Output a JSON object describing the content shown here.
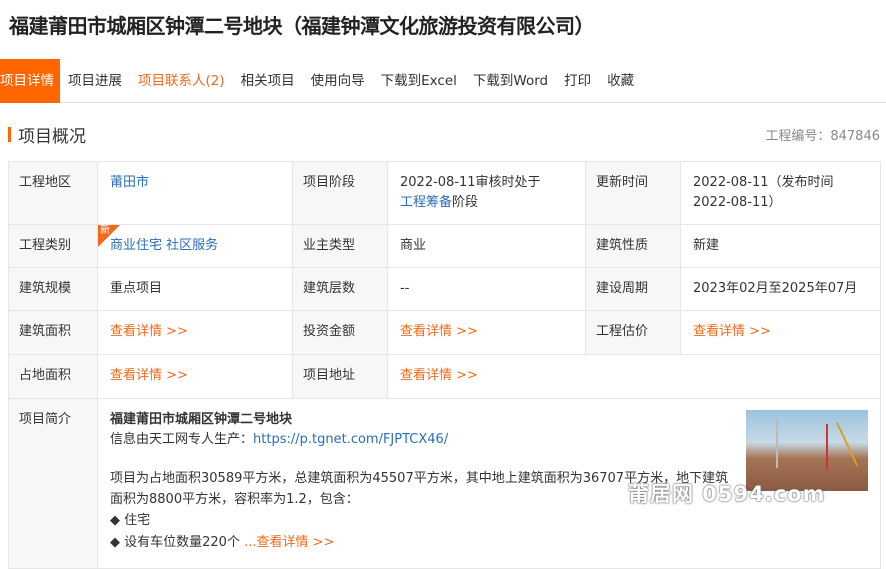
{
  "title": "福建莆田市城厢区钟潭二号地块（福建钟潭文化旅游投资有限公司）",
  "tabs": [
    {
      "label": "项目详情"
    },
    {
      "label": "项目进展"
    },
    {
      "label": "项目联系人(2)"
    },
    {
      "label": "相关项目"
    },
    {
      "label": "使用向导"
    },
    {
      "label": "下载到Excel"
    },
    {
      "label": "下载到Word"
    },
    {
      "label": "打印"
    },
    {
      "label": "收藏"
    }
  ],
  "section": {
    "title": "项目概况",
    "code": "工程编号：847846"
  },
  "fields": {
    "region_label": "工程地区",
    "region": "莆田市",
    "stage_label": "项目阶段",
    "stage_pre": "2022-08-11审核时处于",
    "stage_link": "工程筹备",
    "stage_post": "阶段",
    "update_label": "更新时间",
    "update": "2022-08-11（发布时间2022-08-11）",
    "category_label": "工程类别",
    "new_tag": "新",
    "category": "商业住宅 社区服务",
    "owner_label": "业主类型",
    "owner": "商业",
    "nature_label": "建筑性质",
    "nature": "新建",
    "scale_label": "建筑规模",
    "scale": "重点项目",
    "floors_label": "建筑层数",
    "floors": "--",
    "period_label": "建设周期",
    "period": "2023年02月至2025年07月",
    "area_label": "建筑面积",
    "area": "查看详情 >>",
    "invest_label": "投资金额",
    "invest": "查看详情 >>",
    "cost_label": "工程估价",
    "cost": "查看详情 >>",
    "land_label": "占地面积",
    "land": "查看详情 >>",
    "address_label": "项目地址",
    "address": "查看详情 >>",
    "intro_label": "项目简介"
  },
  "intro": {
    "heading": "福建莆田市城厢区钟潭二号地块",
    "source_pre": "信息由天工网专人生产：",
    "source_link": "https://p.tgnet.com/FJPTCX46/",
    "body": "项目为占地面积30589平方米，总建筑面积为45507平方米，其中地上建筑面积为36707平方米，地下建筑面积为8800平方米，容积率为1.2，包含：",
    "bullets": [
      "◆ 住宅",
      "◆ 设有车位数量220个"
    ],
    "more": "...查看详情 >>"
  },
  "watermark": "莆居网 0594.com"
}
